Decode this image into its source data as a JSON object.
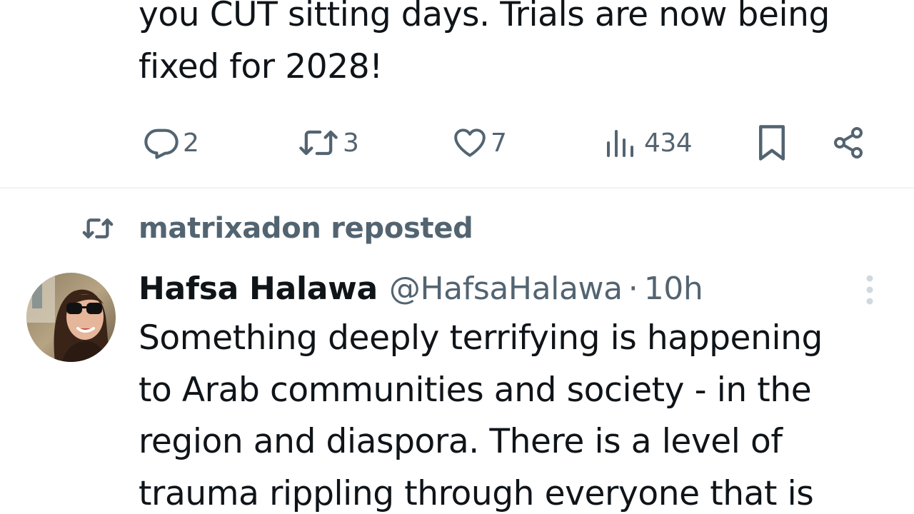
{
  "previous_tweet": {
    "text_lines": [
      "you CUT sitting days. Trials are now being",
      "fixed for 2028!"
    ],
    "actions": {
      "replies": "2",
      "reposts": "3",
      "likes": "7",
      "views": "434"
    }
  },
  "repost_context": {
    "label": "matrixadon reposted",
    "icon": "repost-icon"
  },
  "tweet": {
    "display_name": "Hafsa Halawa",
    "handle": "@HafsaHalawa",
    "separator": "·",
    "time": "10h",
    "text_lines": [
      "Something deeply terrifying is happening",
      "to Arab communities and society - in the",
      "region and diaspora. There is a level of",
      "trauma rippling through everyone that is"
    ]
  },
  "colors": {
    "text_primary": "#0f1419",
    "text_secondary": "#536471",
    "divider": "#eff3f4",
    "more_dots": "#cfd9de"
  }
}
